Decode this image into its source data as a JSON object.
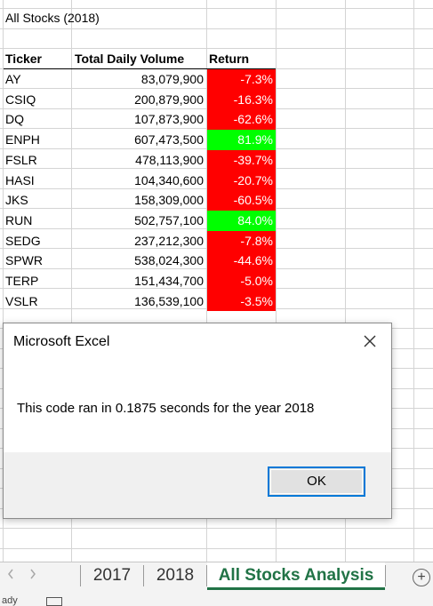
{
  "sheet": {
    "title": "All Stocks (2018)",
    "headers": {
      "ticker": "Ticker",
      "volume": "Total Daily Volume",
      "return": "Return"
    },
    "rows": [
      {
        "ticker": "AY",
        "volume": "83,079,900",
        "return": "-7.3%",
        "status": "negative"
      },
      {
        "ticker": "CSIQ",
        "volume": "200,879,900",
        "return": "-16.3%",
        "status": "negative"
      },
      {
        "ticker": "DQ",
        "volume": "107,873,900",
        "return": "-62.6%",
        "status": "negative"
      },
      {
        "ticker": "ENPH",
        "volume": "607,473,500",
        "return": "81.9%",
        "status": "positive"
      },
      {
        "ticker": "FSLR",
        "volume": "478,113,900",
        "return": "-39.7%",
        "status": "negative"
      },
      {
        "ticker": "HASI",
        "volume": "104,340,600",
        "return": "-20.7%",
        "status": "negative"
      },
      {
        "ticker": "JKS",
        "volume": "158,309,000",
        "return": "-60.5%",
        "status": "negative"
      },
      {
        "ticker": "RUN",
        "volume": "502,757,100",
        "return": "84.0%",
        "status": "positive"
      },
      {
        "ticker": "SEDG",
        "volume": "237,212,300",
        "return": "-7.8%",
        "status": "negative"
      },
      {
        "ticker": "SPWR",
        "volume": "538,024,300",
        "return": "-44.6%",
        "status": "negative"
      },
      {
        "ticker": "TERP",
        "volume": "151,434,700",
        "return": "-5.0%",
        "status": "negative"
      },
      {
        "ticker": "VSLR",
        "volume": "136,539,100",
        "return": "-3.5%",
        "status": "negative"
      }
    ]
  },
  "colors": {
    "negative": "#ff0000",
    "positive": "#00ff00",
    "negative_text": "#ffffff",
    "positive_text": "#ffffff",
    "tab_active": "#217346"
  },
  "dialog": {
    "title": "Microsoft Excel",
    "close_icon": "close-icon",
    "message": "This code ran in 0.1875 seconds for the year 2018",
    "ok_label": "OK"
  },
  "tabs": {
    "items": [
      {
        "label": "2017",
        "active": false
      },
      {
        "label": "2018",
        "active": false
      },
      {
        "label": "All Stocks Analysis",
        "active": true
      }
    ],
    "prev_icon": "chevron-left-icon",
    "next_icon": "chevron-right-icon",
    "add_icon": "plus-circle-icon"
  },
  "status_bar": {
    "text": "ady"
  }
}
